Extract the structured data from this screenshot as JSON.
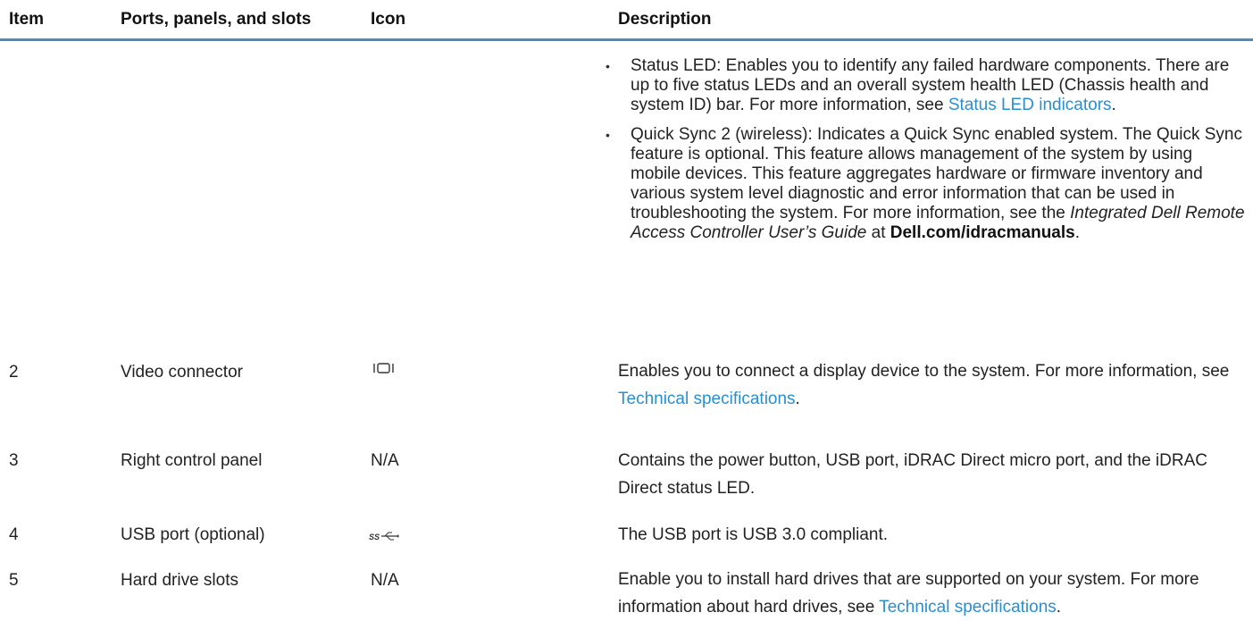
{
  "header": {
    "item": "Item",
    "ports": "Ports, panels, and slots",
    "icon": "Icon",
    "description": "Description"
  },
  "row1": {
    "bullets": [
      {
        "text_before": "Status LED: Enables you to identify any failed hardware components. There are up to five status LEDs and an overall system health LED (Chassis health and system ID) bar. For more information, see ",
        "link": "Status LED indicators",
        "text_after": "."
      },
      {
        "text_before": "Quick Sync 2 (wireless): Indicates a Quick Sync enabled system. The Quick Sync feature is optional. This feature allows management of the system by using mobile devices. This feature aggregates hardware or firmware inventory and various system level diagnostic and error information that can be used in troubleshooting the system. For more information, see the ",
        "italic": "Integrated Dell Remote Access Controller User’s Guide",
        "text_mid": " at ",
        "bold": "Dell.com/idracmanuals",
        "text_after": "."
      }
    ]
  },
  "rows": [
    {
      "item": "2",
      "port": "Video connector",
      "icon_name": "video-connector-icon",
      "desc_before": "Enables you to connect a display device to the system. For more information, see ",
      "desc_link": "Technical specifications",
      "desc_after": "."
    },
    {
      "item": "3",
      "port": "Right control panel",
      "icon_text": "N/A",
      "desc_before": "Contains the power button, USB port, iDRAC Direct micro port, and the iDRAC Direct status LED."
    },
    {
      "item": "4",
      "port": "USB port (optional)",
      "icon_name": "usb-3-icon",
      "desc_before": "The USB port is USB 3.0 compliant."
    },
    {
      "item": "5",
      "port": "Hard drive slots",
      "icon_text": "N/A",
      "desc_before": "Enable you to install hard drives that are supported on your system. For more information about hard drives, see ",
      "desc_link": "Technical specifications",
      "desc_after": "."
    }
  ],
  "colors": {
    "header_rule": "#4a8bc2",
    "link": "#2a8fd0",
    "text": "#222222"
  }
}
